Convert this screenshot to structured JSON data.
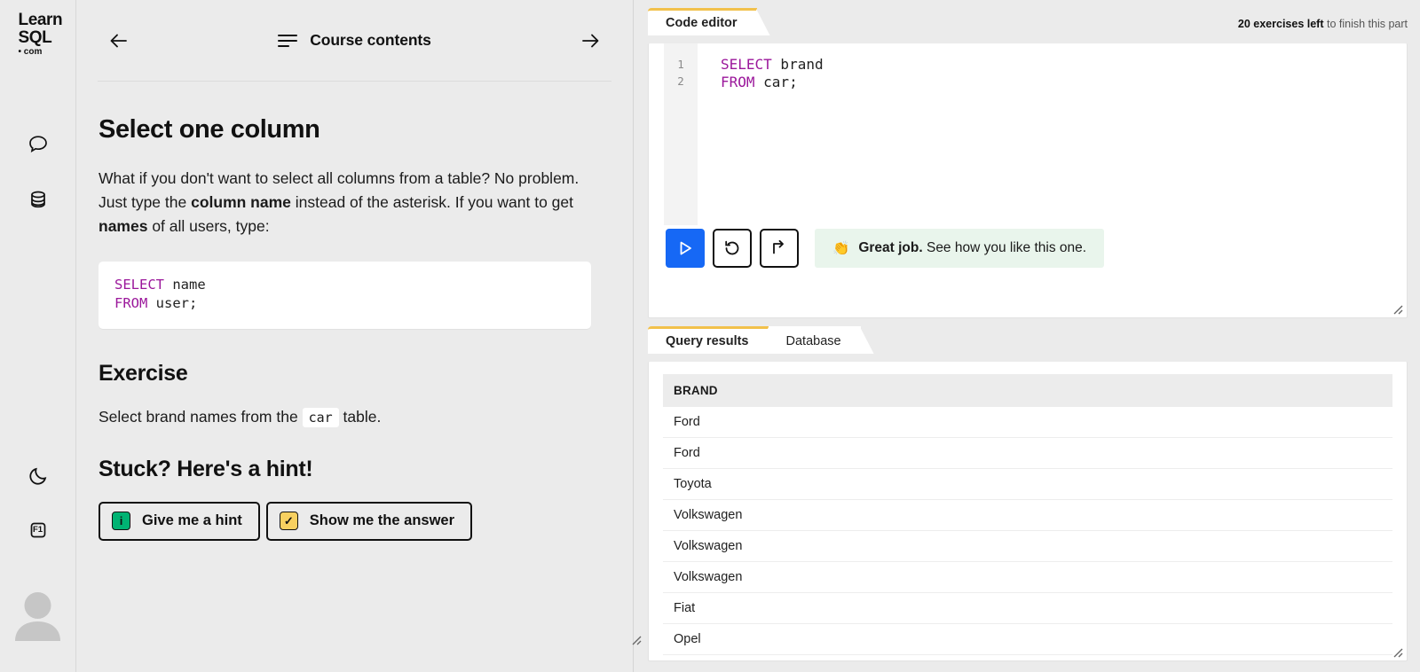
{
  "brand": {
    "logo_line1": "Learn",
    "logo_line2": "SQL",
    "logo_line3": "• com"
  },
  "rail": {
    "items": [
      {
        "icon": "chat-bubble-icon",
        "name": "discussion"
      },
      {
        "icon": "database-icon",
        "name": "database"
      },
      {
        "icon": "moon-icon",
        "name": "dark-mode"
      },
      {
        "icon": "f1-key-icon",
        "name": "help",
        "label": "F1"
      },
      {
        "icon": "avatar-icon",
        "name": "user-avatar"
      }
    ]
  },
  "topnav": {
    "back_label": "←",
    "forward_label": "→",
    "title": "Course contents"
  },
  "lesson": {
    "title": "Select one column",
    "paragraph_part1": "What if you don't want to select all columns from a table? No problem. Just type the ",
    "paragraph_bold1": "column name",
    "paragraph_part2": " instead of the asterisk. If you want to get ",
    "paragraph_bold2": "names",
    "paragraph_part3": " of all users, type:",
    "code": {
      "line1_keyword": "SELECT",
      "line1_rest": " name",
      "line2_keyword": "FROM",
      "line2_rest": " user;"
    },
    "exercise_heading": "Exercise",
    "exercise_text_before": "Select brand names from the ",
    "exercise_code": "car",
    "exercise_text_after": " table.",
    "hint_heading": "Stuck? Here's a hint!",
    "hint_button": "Give me a hint",
    "hint_button_icon_glyph": "i",
    "answer_button": "Show me the answer",
    "answer_button_icon_glyph": "✓"
  },
  "editor": {
    "tab_label": "Code editor",
    "progress_bold": "20 exercises left",
    "progress_rest": " to finish this part",
    "line_numbers": [
      "1",
      "2"
    ],
    "code": {
      "line1_keyword": "SELECT",
      "line1_rest": " brand",
      "line2_keyword": "FROM",
      "line2_rest": " car;"
    },
    "run_button_label": "Run",
    "reset_button_label": "Reset",
    "next_button_label": "Next",
    "feedback_emoji": "👏",
    "feedback_bold": "Great job.",
    "feedback_rest": " See how you like this one."
  },
  "results": {
    "tabs": [
      {
        "label": "Query results",
        "active": true
      },
      {
        "label": "Database",
        "active": false
      }
    ],
    "tab_active_label": "Query results",
    "tab_inactive_label": "Database",
    "columns": [
      "BRAND"
    ],
    "rows": [
      [
        "Ford"
      ],
      [
        "Ford"
      ],
      [
        "Toyota"
      ],
      [
        "Volkswagen"
      ],
      [
        "Volkswagen"
      ],
      [
        "Volkswagen"
      ],
      [
        "Fiat"
      ],
      [
        "Opel"
      ]
    ]
  },
  "colors": {
    "accent_blue": "#1668f5",
    "tab_accent": "#f2c14b",
    "hint_green": "#00b373",
    "answer_yellow": "#f7d060",
    "keyword_purple": "#9b179b",
    "feedback_bg": "#e9f5ec"
  }
}
